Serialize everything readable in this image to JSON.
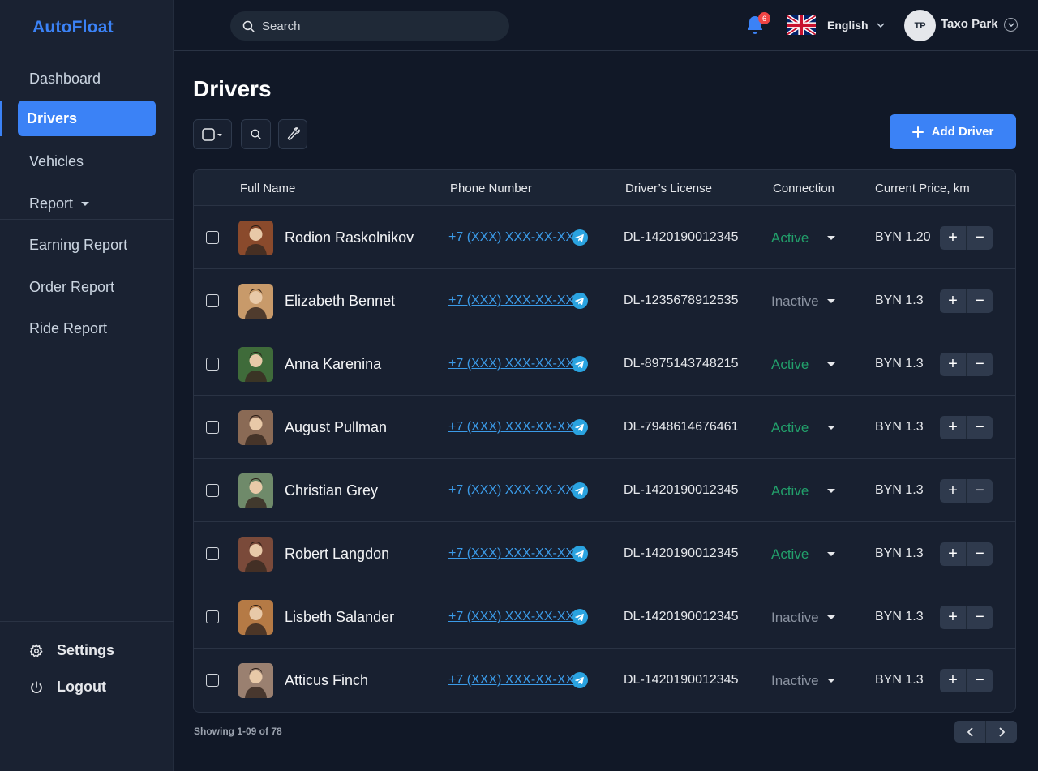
{
  "brand": {
    "name": "AutoFloat",
    "color": "#3b82f6"
  },
  "sidebar": {
    "items": [
      {
        "label": "Dashboard",
        "active": false
      },
      {
        "label": "Drivers",
        "active": true
      },
      {
        "label": "Vehicles",
        "active": false
      },
      {
        "label": "Report",
        "active": false,
        "dropdown": true
      }
    ],
    "reports": [
      {
        "label": "Earning Report"
      },
      {
        "label": "Order Report"
      },
      {
        "label": "Ride Report"
      }
    ],
    "settings_label": "Settings",
    "logout_label": "Logout",
    "settings_icon": "gear-icon",
    "logout_icon": "power-icon"
  },
  "header": {
    "search_placeholder": "Search",
    "notifications_count": "6",
    "language": "English",
    "language_flag": "uk-flag",
    "user_initials": "TP",
    "user_name": "Taxo Park"
  },
  "page": {
    "title": "Drivers",
    "add_button_label": "Add Driver"
  },
  "table": {
    "columns": [
      "Full Name",
      "Phone Number",
      "Driver’s License",
      "Connection",
      "Current Price, km"
    ],
    "rows": [
      {
        "name": "Rodion Raskolnikov",
        "phone": "+7 (XXX) XXX-XX-XX",
        "license": "DL-1420190012345",
        "status": "Active",
        "price": "BYN 1.20",
        "avatar_color": "#8a4a2c"
      },
      {
        "name": "Elizabeth Bennet",
        "phone": "+7 (XXX) XXX-XX-XX",
        "license": "DL-1235678912535",
        "status": "Inactive",
        "price": "BYN 1.3",
        "avatar_color": "#c89a6a"
      },
      {
        "name": "Anna Karenina",
        "phone": "+7 (XXX) XXX-XX-XX",
        "license": "DL-8975143748215",
        "status": "Active",
        "price": "BYN 1.3",
        "avatar_color": "#3f6b3a"
      },
      {
        "name": "August Pullman",
        "phone": "+7 (XXX) XXX-XX-XX",
        "license": "DL-7948614676461",
        "status": "Active",
        "price": "BYN 1.3",
        "avatar_color": "#8a6a55"
      },
      {
        "name": "Christian Grey",
        "phone": "+7 (XXX) XXX-XX-XX",
        "license": "DL-1420190012345",
        "status": "Active",
        "price": "BYN 1.3",
        "avatar_color": "#6f8a6a"
      },
      {
        "name": "Robert Langdon",
        "phone": "+7 (XXX) XXX-XX-XX",
        "license": "DL-1420190012345",
        "status": "Active",
        "price": "BYN 1.3",
        "avatar_color": "#7a4a3a"
      },
      {
        "name": "Lisbeth Salander",
        "phone": "+7 (XXX) XXX-XX-XX",
        "license": "DL-1420190012345",
        "status": "Inactive",
        "price": "BYN 1.3",
        "avatar_color": "#b57a45"
      },
      {
        "name": "Atticus Finch",
        "phone": "+7 (XXX) XXX-XX-XX",
        "license": "DL-1420190012345",
        "status": "Inactive",
        "price": "BYN 1.3",
        "avatar_color": "#9a8070"
      }
    ]
  },
  "footer": {
    "showing": "Showing 1-09 of 78"
  },
  "colors": {
    "active": "#22a06b",
    "inactive": "#8b93a1",
    "link": "#3b9be8"
  }
}
